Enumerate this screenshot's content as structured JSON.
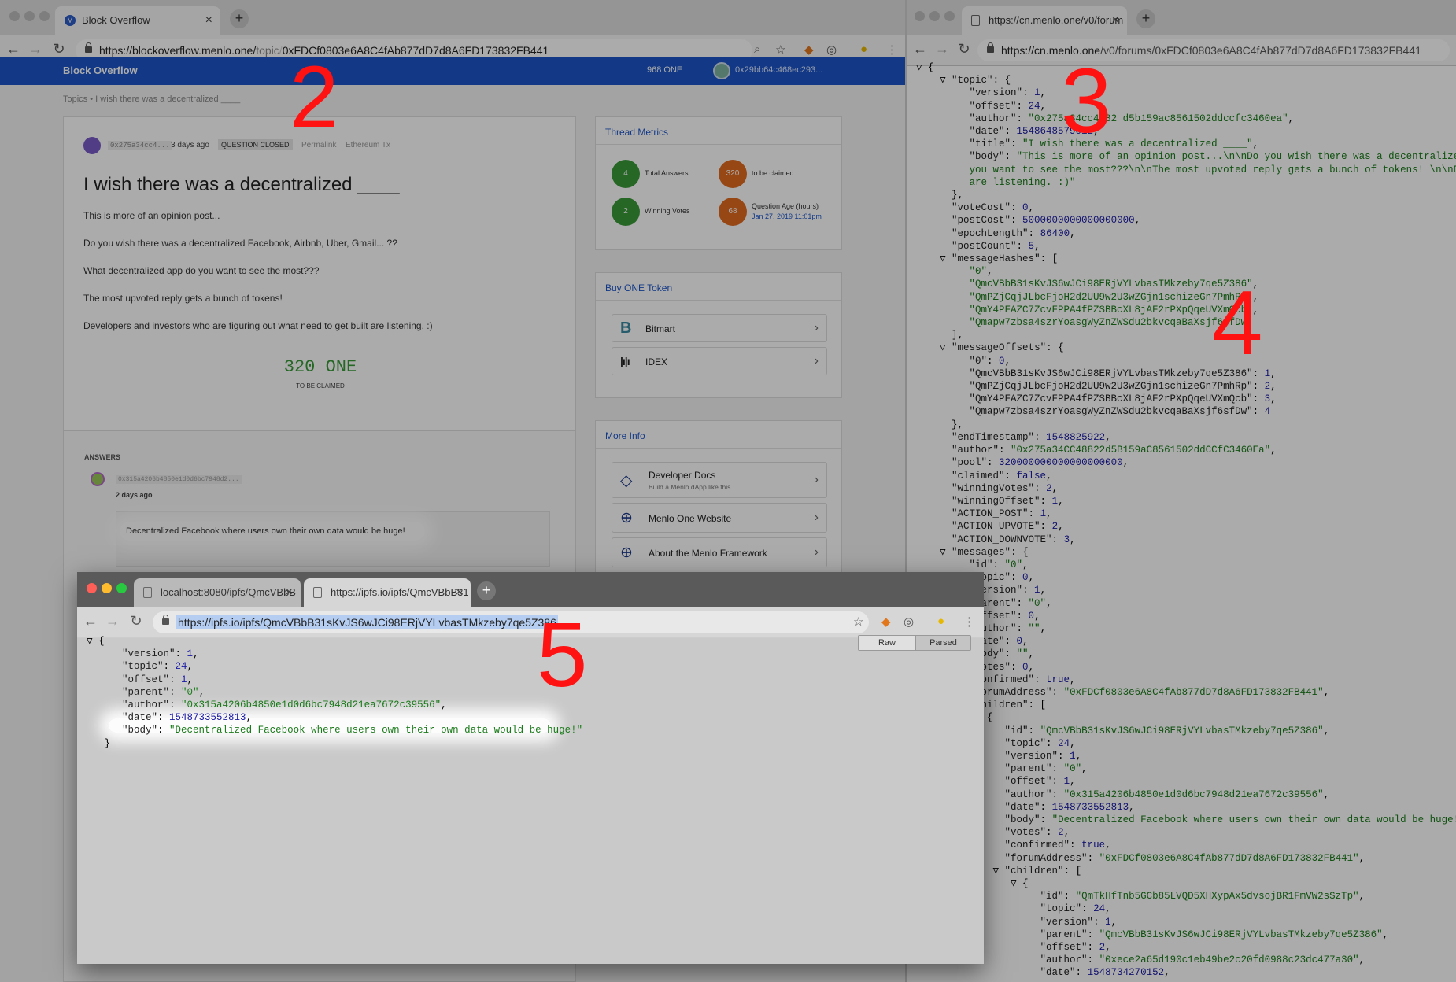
{
  "left_window": {
    "tab_title": "Block Overflow",
    "url_host": "https://blockoverflow.menlo.one/",
    "url_path": "topic/",
    "url_hash": "0xFDCf0803e6A8C4fAb877dD7d8A6FD173832FB441",
    "app_name": "Block Overflow",
    "balance": "968 ONE",
    "account": "0x29bb64c468ec293...",
    "breadcrumb": "Topics • I wish there was a decentralized ____",
    "post": {
      "author": "0x275a34cc4...",
      "age": "3 days ago",
      "status": "QUESTION CLOSED",
      "permalink": "Permalink",
      "ethereum_tx": "Ethereum Tx",
      "title": "I wish there was a decentralized ____",
      "paragraphs": [
        "This is more of an opinion post...",
        "Do you wish there was a decentralized Facebook, Airbnb, Uber, Gmail... ??",
        "What decentralized app do you want to see the most???",
        "The most upvoted reply gets a bunch of tokens!",
        "Developers and investors who are figuring out what need to get built are listening. :)"
      ],
      "reward": "320 ONE",
      "reward_caption": "TO BE CLAIMED"
    },
    "answers": {
      "heading": "ANSWERS",
      "author": "0x315a4206b4850e1d0d6bc7948d2...",
      "age": "2 days ago",
      "body": "Decentralized Facebook where users own their own data would be huge!"
    },
    "thread_metrics": {
      "title": "Thread Metrics",
      "total_answers_value": "4",
      "total_answers_label": "Total Answers",
      "to_claim_value": "320",
      "to_claim_label": "to be claimed",
      "winning_votes_value": "2",
      "winning_votes_label": "Winning Votes",
      "age_value": "68",
      "age_label": "Question Age (hours)",
      "age_date": "Jan 27, 2019 11:01pm"
    },
    "buy_token": {
      "title": "Buy ONE Token",
      "items": [
        "Bitmart",
        "IDEX"
      ]
    },
    "more_info": {
      "title": "More Info",
      "dev_docs": "Developer Docs",
      "dev_docs_sub": "Build a Menlo dApp like this",
      "website": "Menlo One Website",
      "framework": "About the Menlo Framework"
    }
  },
  "right_window": {
    "tab_title": "https://cn.menlo.one/v0/forum",
    "url_host": "https://cn.menlo.one",
    "url_path": "/v0/forums/0xFDCf0803e6A8C4fAb877dD7d8A6FD173832FB441"
  },
  "front_window": {
    "tab1_title": "localhost:8080/ipfs/QmcVBbB",
    "tab2_title": "https://ipfs.io/ipfs/QmcVBbB31",
    "url": "https://ipfs.io/ipfs/QmcVBbB31sKvJS6wJCi98ERjVYLvbasTMkzeby7qe5Z386",
    "raw_label": "Raw",
    "parsed_label": "Parsed"
  },
  "annotations": [
    "2",
    "3",
    "4",
    "5"
  ],
  "colors": {
    "header_blue": "#1d56c8",
    "annotation_red": "#ff1212",
    "metric_green": "#3a9a3a",
    "metric_orange": "#e06a1e",
    "json_string": "#1a7a1a",
    "json_number": "#1a1aa6"
  }
}
